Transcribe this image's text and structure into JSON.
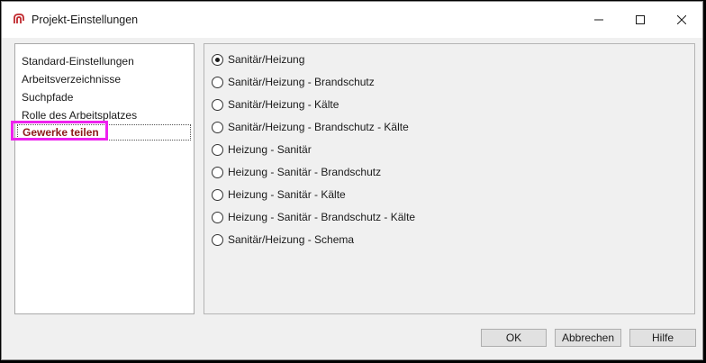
{
  "window": {
    "title": "Projekt-Einstellungen",
    "app_icon": "app-logo-icon",
    "controls": {
      "minimize_icon": "minimize-icon",
      "maximize_icon": "maximize-icon",
      "close_icon": "close-icon"
    }
  },
  "nav": {
    "items": [
      {
        "label": "Standard-Einstellungen",
        "selected": false
      },
      {
        "label": "Arbeitsverzeichnisse",
        "selected": false
      },
      {
        "label": "Suchpfade",
        "selected": false
      },
      {
        "label": "Rolle des Arbeitsplatzes",
        "selected": false
      },
      {
        "label": "Gewerke teilen",
        "selected": true
      }
    ]
  },
  "options": {
    "items": [
      {
        "label": "Sanitär/Heizung",
        "checked": true
      },
      {
        "label": "Sanitär/Heizung - Brandschutz",
        "checked": false
      },
      {
        "label": "Sanitär/Heizung - Kälte",
        "checked": false
      },
      {
        "label": "Sanitär/Heizung - Brandschutz - Kälte",
        "checked": false
      },
      {
        "label": "Heizung - Sanitär",
        "checked": false
      },
      {
        "label": "Heizung - Sanitär - Brandschutz",
        "checked": false
      },
      {
        "label": "Heizung - Sanitär - Kälte",
        "checked": false
      },
      {
        "label": "Heizung - Sanitär - Brandschutz - Kälte",
        "checked": false
      },
      {
        "label": "Sanitär/Heizung - Schema",
        "checked": false
      }
    ]
  },
  "footer": {
    "ok_label": "OK",
    "cancel_label": "Abbrechen",
    "help_label": "Hilfe"
  },
  "colors": {
    "selected_text": "#8b1a1a",
    "highlight": "#ee22ee",
    "app_icon": "#c0282d"
  }
}
